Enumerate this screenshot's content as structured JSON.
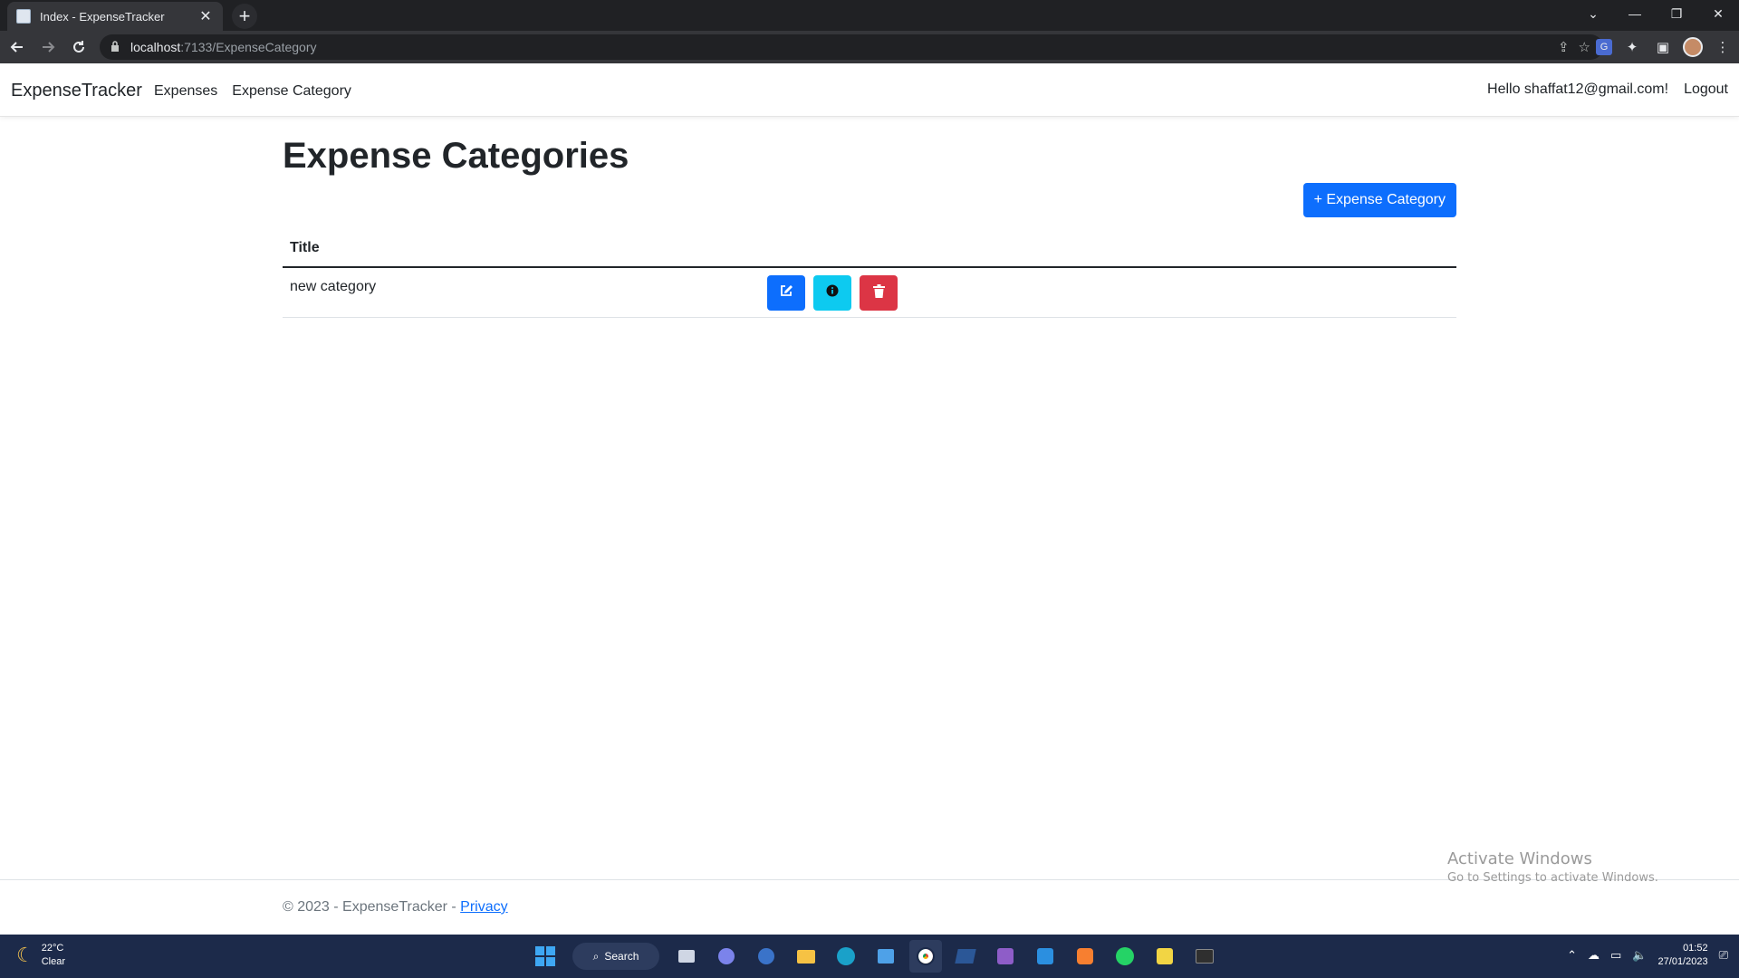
{
  "browser": {
    "tab_title": "Index - ExpenseTracker",
    "tab_close": "✕",
    "new_tab": "+",
    "url_host": "localhost",
    "url_path": ":7133/ExpenseCategory",
    "window_controls": {
      "chevron": "⌄",
      "minimize": "—",
      "restore": "❐",
      "close": "✕"
    }
  },
  "app_nav": {
    "brand": "ExpenseTracker",
    "links": [
      "Expenses",
      "Expense Category"
    ],
    "greeting": "Hello shaffat12@gmail.com!",
    "logout": "Logout"
  },
  "main": {
    "title": "Expense Categories",
    "add_button": "+ Expense Category",
    "table": {
      "headers": [
        "Title"
      ],
      "rows": [
        {
          "title": "new category",
          "actions": [
            "edit-icon",
            "info-icon",
            "trash-icon"
          ]
        }
      ]
    }
  },
  "footer": {
    "text": "© 2023 - ExpenseTracker - ",
    "privacy_link": "Privacy"
  },
  "watermark": {
    "line1": "Activate Windows",
    "line2": "Go to Settings to activate Windows."
  },
  "taskbar": {
    "weather_temp": "22°C",
    "weather_desc": "Clear",
    "search_label": "Search",
    "time": "01:52",
    "date": "27/01/2023"
  },
  "colors": {
    "primary": "#0d6efd",
    "info": "#0dcaf0",
    "danger": "#dc3545",
    "taskbar": "#1c2a4a"
  }
}
